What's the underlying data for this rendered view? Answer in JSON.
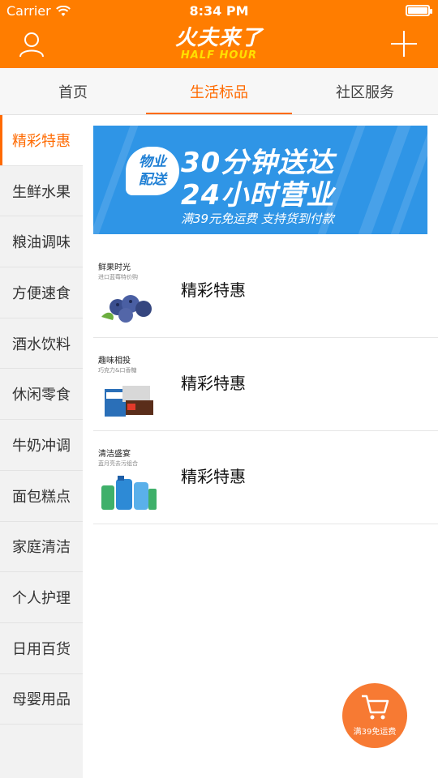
{
  "status_bar": {
    "carrier": "Carrier",
    "time": "8:34 PM",
    "battery_level": 1.0
  },
  "header": {
    "logo_cn": "火夫来了",
    "logo_en": "HALF HOUR",
    "user_icon": "user-icon",
    "add_icon": "plus-icon",
    "brand_color": "#ff7d00"
  },
  "tabs": [
    {
      "label": "首页",
      "active": false
    },
    {
      "label": "生活标品",
      "active": true
    },
    {
      "label": "社区服务",
      "active": false
    }
  ],
  "sidebar": {
    "items": [
      {
        "label": "精彩特惠",
        "active": true
      },
      {
        "label": "生鲜水果"
      },
      {
        "label": "粮油调味"
      },
      {
        "label": "方便速食"
      },
      {
        "label": "酒水饮料"
      },
      {
        "label": "休闲零食"
      },
      {
        "label": "牛奶冲调"
      },
      {
        "label": "面包糕点"
      },
      {
        "label": "家庭清洁"
      },
      {
        "label": "个人护理"
      },
      {
        "label": "日用百货"
      },
      {
        "label": "母婴用品"
      }
    ]
  },
  "banner": {
    "badge_line1": "物业",
    "badge_line2": "配送",
    "line1": "30分钟送达",
    "line2": "24小时营业",
    "subline": "满39元免运费  支持货到付款",
    "background": "#2f95e6"
  },
  "products": [
    {
      "image_title": "鲜果时光",
      "image_sub": "进口蓝莓特价购",
      "name": "精彩特惠"
    },
    {
      "image_title": "趣味相投",
      "image_sub": "巧克力&口香糖",
      "name": "精彩特惠"
    },
    {
      "image_title": "清洁盛宴",
      "image_sub": "蓝月亮去污组合",
      "name": "精彩特惠"
    }
  ],
  "cart": {
    "label": "满39免运费",
    "icon": "cart-icon",
    "color": "#f77a33"
  },
  "accent_color": "#ff6a00"
}
